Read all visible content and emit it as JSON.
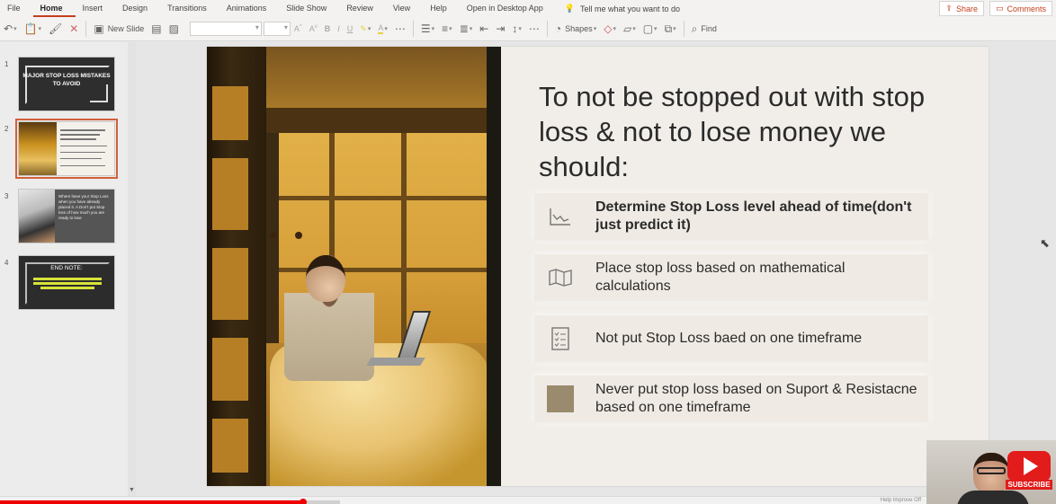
{
  "menu": {
    "tabs": [
      "File",
      "Home",
      "Insert",
      "Design",
      "Transitions",
      "Animations",
      "Slide Show",
      "Review",
      "View",
      "Help",
      "Open in Desktop App"
    ],
    "active_tab": "Home",
    "tell_me": "Tell me what you want to do",
    "share": "Share",
    "comments": "Comments"
  },
  "toolbar": {
    "new_slide": "New Slide",
    "shapes": "Shapes",
    "find": "Find"
  },
  "thumbnails": {
    "numbers": [
      "1",
      "2",
      "3",
      "4"
    ],
    "slide1_title": "MAJOR STOP LOSS MISTAKES TO AVOID",
    "slide3_text": "Where have your Stop Loss when you have already placed it. A Don't put Stop loss of how much you are ready to lose",
    "slide4_title": "END NOTE:"
  },
  "slide": {
    "heading": "To not be stopped out with stop loss & not to lose money we should:",
    "items": [
      {
        "icon": "line-chart-icon",
        "text": "Determine Stop Loss level ahead of time(don't just predict it)",
        "bold": true
      },
      {
        "icon": "map-icon",
        "text": "Place stop loss based on mathematical calculations",
        "bold": false
      },
      {
        "icon": "checklist-icon",
        "text": "Not put Stop Loss baed on one timeframe",
        "bold": false
      },
      {
        "icon": "square-icon",
        "text": " Never put stop loss based on Suport & Resistacne based on one timeframe",
        "bold": false
      }
    ]
  },
  "status": {
    "text": "Help Improve Off"
  },
  "video": {
    "progress": 0.287,
    "subscribe": "SUBSCRIBE"
  },
  "colors": {
    "accent": "#c43e1c",
    "progress": "#ee0000",
    "subscribe": "#e21b1b"
  }
}
